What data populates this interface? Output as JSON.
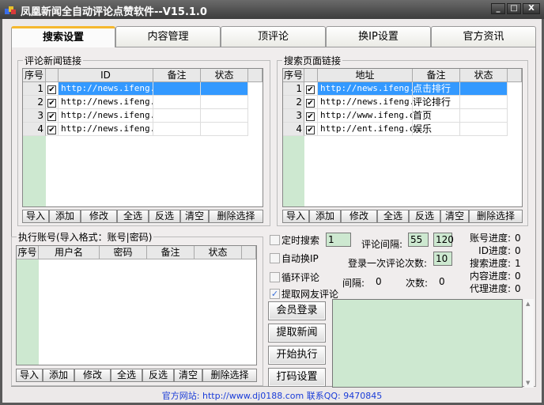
{
  "window": {
    "title": "凤凰新闻全自动评论点赞软件--V15.1.0",
    "minimize": "_",
    "maximize": "□",
    "close": "X"
  },
  "tabs": [
    {
      "label": "搜索设置",
      "active": true
    },
    {
      "label": "内容管理"
    },
    {
      "label": "顶评论"
    },
    {
      "label": "换IP设置"
    },
    {
      "label": "官方资讯"
    }
  ],
  "news_links": {
    "title": "评论新闻链接",
    "headers": [
      "序号",
      "",
      "ID",
      "备注",
      "状态"
    ],
    "rows": [
      {
        "n": "1",
        "checked": true,
        "id": "http://news.ifeng.c",
        "note": "",
        "status": ""
      },
      {
        "n": "2",
        "checked": true,
        "id": "http://news.ifeng.c",
        "note": "",
        "status": ""
      },
      {
        "n": "3",
        "checked": true,
        "id": "http://news.ifeng.c",
        "note": "",
        "status": ""
      },
      {
        "n": "4",
        "checked": true,
        "id": "http://news.ifeng.c",
        "note": "",
        "status": ""
      }
    ]
  },
  "search_links": {
    "title": "搜索页面链接",
    "headers": [
      "序号",
      "",
      "地址",
      "备注",
      "状态"
    ],
    "rows": [
      {
        "n": "1",
        "checked": true,
        "id": "http://news.ifeng.c",
        "note": "点击排行",
        "status": ""
      },
      {
        "n": "2",
        "checked": true,
        "id": "http://news.ifeng.c",
        "note": "评论排行",
        "status": ""
      },
      {
        "n": "3",
        "checked": true,
        "id": "http://www.ifeng.co",
        "note": "首页",
        "status": ""
      },
      {
        "n": "4",
        "checked": true,
        "id": "http://ent.ifeng.co",
        "note": "娱乐",
        "status": ""
      }
    ]
  },
  "accounts": {
    "title": "执行账号(导入格式：账号|密码)",
    "headers": [
      "序号",
      "用户名",
      "密码",
      "备注",
      "状态"
    ]
  },
  "list_buttons": [
    "导入",
    "添加",
    "修改",
    "全选",
    "反选",
    "清空",
    "删除选择"
  ],
  "options": {
    "timed_search": {
      "label": "定时搜索",
      "checked": false,
      "value": "1"
    },
    "auto_ip": {
      "label": "自动换IP",
      "checked": false
    },
    "loop_comment": {
      "label": "循环评论",
      "checked": false
    },
    "fetch_comments": {
      "label": "提取网友评论",
      "checked": true
    }
  },
  "settings": {
    "interval_label": "评论间隔:",
    "interval_min": "55",
    "interval_max": "120",
    "per_login_label": "登录一次评论次数:",
    "per_login": "10",
    "gap_label": "间隔:",
    "gap": "0",
    "count_label": "次数:",
    "count": "0"
  },
  "progress": [
    {
      "label": "账号进度:",
      "value": "0"
    },
    {
      "label": "ID进度:",
      "value": "0"
    },
    {
      "label": "搜索进度:",
      "value": "1"
    },
    {
      "label": "内容进度:",
      "value": "0"
    },
    {
      "label": "代理进度:",
      "value": "0"
    }
  ],
  "actions": [
    "会员登录",
    "提取新闻",
    "开始执行",
    "打码设置"
  ],
  "log": "",
  "footer": "官方网站: http://www.dj0188.com 联系QQ: 9470845",
  "colors": {
    "accent": "#3399ff",
    "grid_green": "#cde8d0",
    "footer_text": "#1a3cd8",
    "tab_active": "#f5b82e"
  }
}
